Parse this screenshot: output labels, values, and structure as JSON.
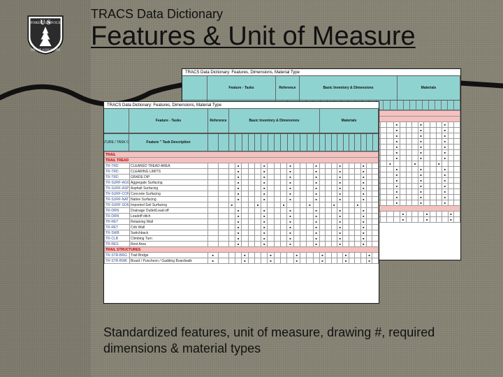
{
  "header": {
    "subtitle": "TRACS Data Dictionary",
    "title": "Features & Unit of Measure"
  },
  "caption": "Standardized features, unit of measure, drawing #, required dimensions & material types",
  "sheetTitle": "TRACS Data Dictionary: Features, Dimensions, Material Type",
  "headers": {
    "feature_tasks": "Feature - Tasks",
    "code": "FEATURE / TASK Code",
    "desc": "Feature \" Task Description",
    "reference": "Reference",
    "basic": "Basic Inventory & Dimensions",
    "materials": "Materials"
  },
  "sections": [
    {
      "title": "TRAIL",
      "rows": []
    },
    {
      "title": "TRAIL TREAD",
      "rows": [
        {
          "code": "TR-TRD",
          "label": "CLEARED TREAD AREA"
        },
        {
          "code": "TR-TRD",
          "label": "CLEARING LIMITS"
        },
        {
          "code": "TR-TRD",
          "label": "GRADE DIP"
        },
        {
          "code": "TR-SURF-AGG",
          "label": "Aggregate Surfacing"
        },
        {
          "code": "TR-SURF-ASP",
          "label": "Asphalt Surfacing"
        },
        {
          "code": "TR-SURF-CON",
          "label": "Concrete Surfacing"
        },
        {
          "code": "TR-SURF-NAT",
          "label": "Native Surfacing"
        },
        {
          "code": "TR-SURF-SOIL",
          "label": "Imported Soil Surfacing"
        },
        {
          "code": "TR-DRN",
          "label": "Drainage Outlet/Lead-off"
        },
        {
          "code": "TR-DRN",
          "label": "Leadoff ditch"
        },
        {
          "code": "TR-RET",
          "label": "Retaining Wall"
        },
        {
          "code": "TR-RET",
          "label": "Crib Wall"
        },
        {
          "code": "TR-SWB",
          "label": "Switchback"
        },
        {
          "code": "TR-CLB",
          "label": "Climbing Turn"
        },
        {
          "code": "TR-RES",
          "label": "Rest Area"
        }
      ]
    },
    {
      "title": "TRAIL STRUCTURES",
      "rows": [
        {
          "code": "TR-STR-BRG",
          "label": "Trail Bridge"
        },
        {
          "code": "TR-STR-BWK",
          "label": "Board / Puncheon / Gadding Boardwalk"
        }
      ]
    }
  ],
  "colSet": {
    "refCols": 2,
    "basicCols": 14,
    "matCols": 10
  }
}
